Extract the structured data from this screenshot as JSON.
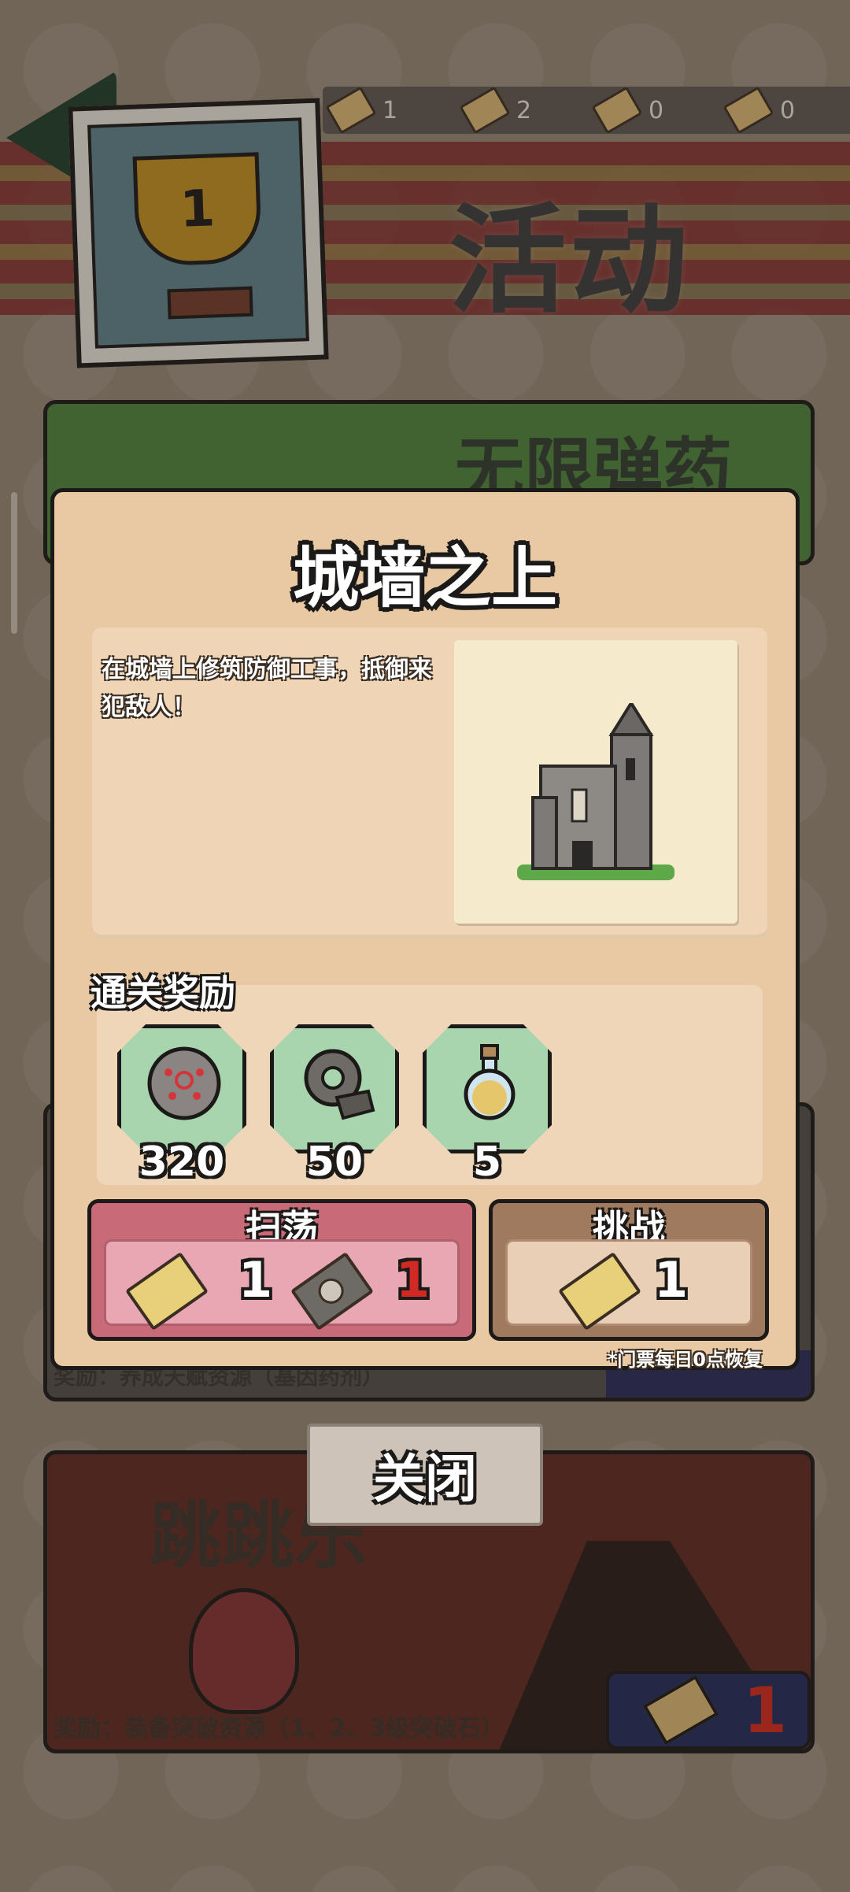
{
  "header": {
    "title": "活动",
    "trophy_rank": "1",
    "tickets": [
      {
        "icon": "event-ticket-icon",
        "count": "1"
      },
      {
        "icon": "event-ticket-icon",
        "count": "2"
      },
      {
        "icon": "event-ticket-icon",
        "count": "0"
      },
      {
        "icon": "event-ticket-icon",
        "count": "0"
      }
    ]
  },
  "background_cards": {
    "card1_title": "无限弹药",
    "card_mid_reward": "奖励：养成天赋资源（基因药剂）",
    "card3_title": "跳跳乐",
    "card3_reward": "奖励：装备突破资源（1、2、3级突破石）",
    "card3_ticket_count": "1"
  },
  "modal": {
    "title": "城墙之上",
    "description": "在城墙上修筑防御工事，抵御来犯敌人！",
    "rewards_label": "通关奖励",
    "rewards": [
      {
        "icon": "gene-orb-icon",
        "count": "320"
      },
      {
        "icon": "gear-ore-icon",
        "count": "50"
      },
      {
        "icon": "potion-bottle-icon",
        "count": "5"
      }
    ],
    "sweep": {
      "label": "扫荡",
      "ticket_count": "1",
      "sweep_ticket_count": "1"
    },
    "challenge": {
      "label": "挑战",
      "ticket_count": "1"
    },
    "footnote": "*门票每日0点恢复",
    "close_label": "关闭"
  },
  "colors": {
    "modal_bg": "#e8c9a4",
    "sweep_bg": "#c96a78",
    "challenge_bg": "#a07a5f",
    "reward_bg": "#a8d5ae",
    "red_count": "#d12a24"
  }
}
